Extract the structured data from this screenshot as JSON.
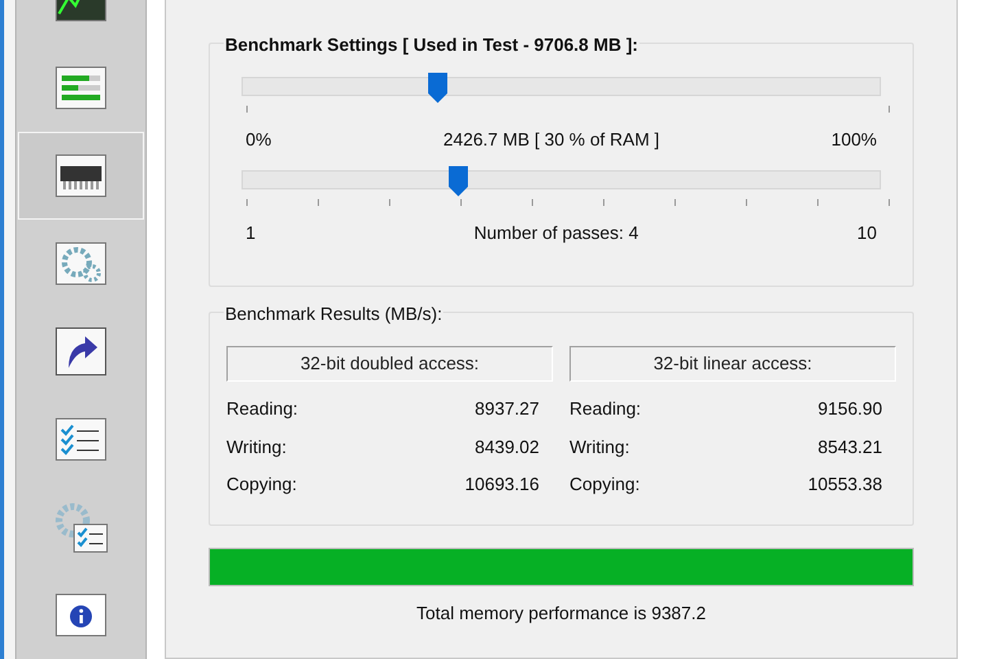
{
  "sidebar": {
    "items": [
      {
        "kind": "chart",
        "selected": false
      },
      {
        "kind": "bars",
        "selected": false
      },
      {
        "kind": "chip",
        "selected": true
      },
      {
        "kind": "gears",
        "selected": false
      },
      {
        "kind": "shortcut",
        "selected": false
      },
      {
        "kind": "checklist",
        "selected": false
      },
      {
        "kind": "gear-checklist",
        "selected": false
      },
      {
        "kind": "info",
        "selected": false
      }
    ]
  },
  "settings": {
    "title": "Benchmark Settings [ Used in Test - 9706.8 MB ]:",
    "memory_slider": {
      "level": 0.3,
      "min_label": "0%",
      "reading": "2426.7 MB [ 30 % of RAM ]",
      "max_label": "100%",
      "kind": "percent"
    },
    "passes_slider": {
      "level": 0.333,
      "min_label": "1",
      "reading": "Number of passes: 4",
      "max_label": "10",
      "kind": "count"
    }
  },
  "results": {
    "title": "Benchmark Results (MB/s):",
    "columns": [
      {
        "heading": "32-bit doubled access:",
        "rows": [
          {
            "label": "Reading:",
            "value": "8937.27"
          },
          {
            "label": "Writing:",
            "value": "8439.02"
          },
          {
            "label": "Copying:",
            "value": "10693.16"
          }
        ]
      },
      {
        "heading": "32-bit linear access:",
        "rows": [
          {
            "label": "Reading:",
            "value": "9156.90"
          },
          {
            "label": "Writing:",
            "value": "8543.21"
          },
          {
            "label": "Copying:",
            "value": "10553.38"
          }
        ]
      }
    ]
  },
  "progress": {
    "level": 1
  },
  "total": "Total memory performance is 9387.2"
}
